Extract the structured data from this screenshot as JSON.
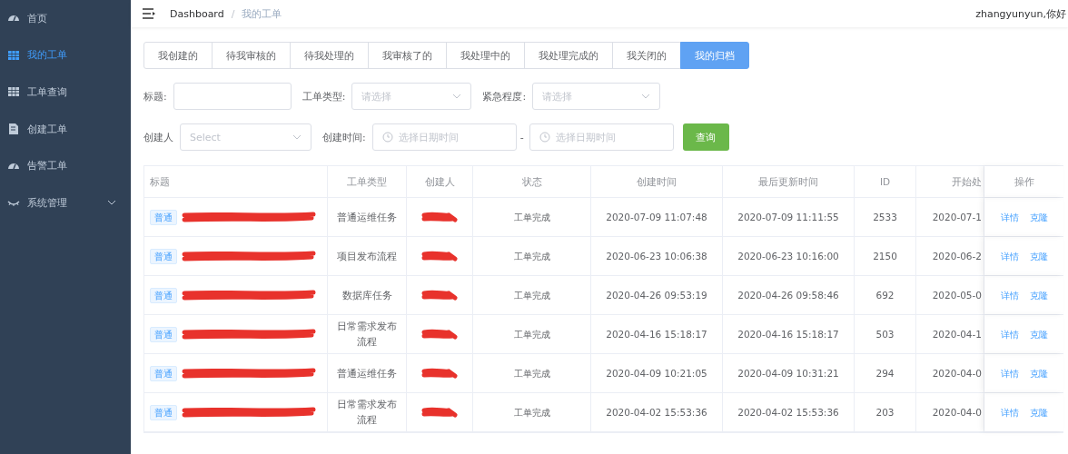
{
  "sidebar": {
    "items": [
      {
        "label": "首页",
        "selected": false
      },
      {
        "label": "我的工单",
        "selected": true
      },
      {
        "label": "工单查询",
        "selected": false
      },
      {
        "label": "创建工单",
        "selected": false
      },
      {
        "label": "告警工单",
        "selected": false
      },
      {
        "label": "系统管理",
        "selected": false,
        "expandable": true
      }
    ]
  },
  "header": {
    "breadcrumb": [
      "Dashboard",
      "我的工单"
    ],
    "breadcrumb_separator": "/",
    "user": "zhangyunyun,你好"
  },
  "tabs": [
    {
      "label": "我创建的",
      "selected": false
    },
    {
      "label": "待我审核的",
      "selected": false
    },
    {
      "label": "待我处理的",
      "selected": false
    },
    {
      "label": "我审核了的",
      "selected": false
    },
    {
      "label": "我处理中的",
      "selected": false
    },
    {
      "label": "我处理完成的",
      "selected": false
    },
    {
      "label": "我关闭的",
      "selected": false
    },
    {
      "label": "我的归档",
      "selected": true
    }
  ],
  "filters": {
    "title_label": "标题:",
    "type_label": "工单类型:",
    "type_placeholder": "请选择",
    "urgency_label": "紧急程度:",
    "urgency_placeholder": "请选择",
    "creator_label": "创建人",
    "creator_placeholder": "Select",
    "time_label": "创建时间:",
    "time_start_placeholder": "选择日期时间",
    "time_separator": "-",
    "time_end_placeholder": "选择日期时间",
    "search_button": "查询"
  },
  "table": {
    "columns": [
      "标题",
      "工单类型",
      "创建人",
      "状态",
      "创建时间",
      "最后更新时间",
      "ID",
      "开始处",
      "操作"
    ],
    "rows": [
      {
        "tag": "普通",
        "title_redacted": true,
        "type": "普通运维任务",
        "creator_redacted": true,
        "status": "工单完成",
        "created": "2020-07-09 11:07:48",
        "updated": "2020-07-09 11:11:55",
        "id": "2533",
        "start": "2020-07-1",
        "actions": [
          "详情",
          "克隆"
        ]
      },
      {
        "tag": "普通",
        "title_redacted": true,
        "type": "项目发布流程",
        "creator_redacted": true,
        "status": "工单完成",
        "created": "2020-06-23 10:06:38",
        "updated": "2020-06-23 10:16:00",
        "id": "2150",
        "start": "2020-06-2",
        "actions": [
          "详情",
          "克隆"
        ]
      },
      {
        "tag": "普通",
        "title_redacted": true,
        "type": "数据库任务",
        "creator_redacted": true,
        "status": "工单完成",
        "created": "2020-04-26 09:53:19",
        "updated": "2020-04-26 09:58:46",
        "id": "692",
        "start": "2020-05-0",
        "actions": [
          "详情",
          "克隆"
        ]
      },
      {
        "tag": "普通",
        "title_redacted": true,
        "type": "日常需求发布流程",
        "creator_redacted": true,
        "status": "工单完成",
        "created": "2020-04-16 15:18:17",
        "updated": "2020-04-16 15:18:17",
        "id": "503",
        "start": "2020-04-1",
        "actions": [
          "详情",
          "克隆"
        ]
      },
      {
        "tag": "普通",
        "title_redacted": true,
        "type": "普通运维任务",
        "creator_redacted": true,
        "status": "工单完成",
        "created": "2020-04-09 10:21:05",
        "updated": "2020-04-09 10:31:21",
        "id": "294",
        "start": "2020-04-0",
        "actions": [
          "详情",
          "克隆"
        ]
      },
      {
        "tag": "普通",
        "title_redacted": true,
        "type": "日常需求发布流程",
        "creator_redacted": true,
        "status": "工单完成",
        "created": "2020-04-02 15:53:36",
        "updated": "2020-04-02 15:53:36",
        "id": "203",
        "start": "2020-04-0",
        "actions": [
          "详情",
          "克隆"
        ]
      }
    ]
  }
}
